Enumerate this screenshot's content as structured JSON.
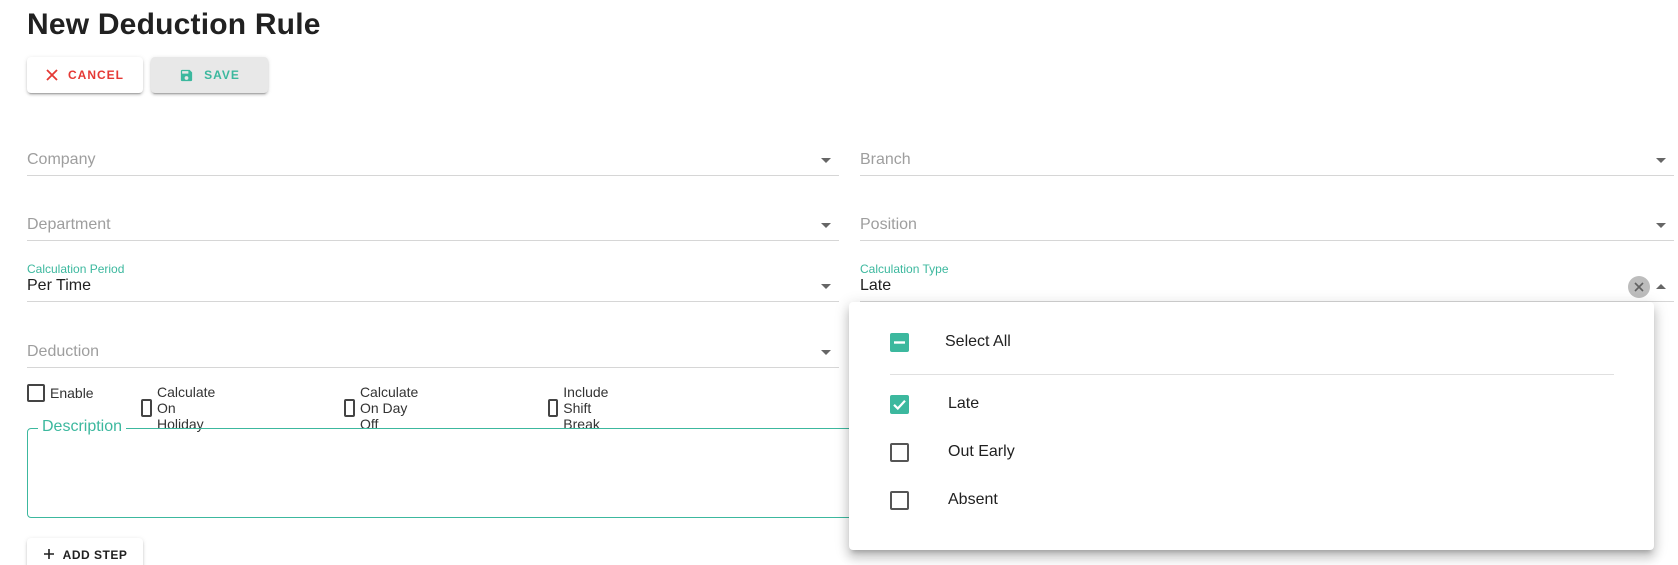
{
  "page": {
    "title": "New Deduction Rule"
  },
  "toolbar": {
    "cancel_label": "CANCEL",
    "save_label": "SAVE"
  },
  "colors": {
    "accent": "#3cb89e",
    "danger": "#e53935"
  },
  "fields": {
    "company": {
      "placeholder": "Company",
      "value": ""
    },
    "branch": {
      "placeholder": "Branch",
      "value": ""
    },
    "department": {
      "placeholder": "Department",
      "value": ""
    },
    "position": {
      "placeholder": "Position",
      "value": ""
    },
    "calculation_period": {
      "label": "Calculation Period",
      "value": "Per Time"
    },
    "calculation_type": {
      "label": "Calculation Type",
      "value": "Late"
    },
    "deduction": {
      "placeholder": "Deduction",
      "value": ""
    },
    "description": {
      "label": "Description",
      "value": ""
    }
  },
  "checkboxes": [
    {
      "label": "Enable",
      "checked": false
    },
    {
      "label": "Calculate On Holiday",
      "checked": false
    },
    {
      "label": "Calculate On Day Off",
      "checked": false
    },
    {
      "label": "Include Shift Break",
      "checked": false
    }
  ],
  "add_step_label": "ADD STEP",
  "calculation_type_menu": {
    "select_all": {
      "label": "Select All",
      "state": "indeterminate"
    },
    "options": [
      {
        "label": "Late",
        "checked": true
      },
      {
        "label": "Out Early",
        "checked": false
      },
      {
        "label": "Absent",
        "checked": false
      }
    ]
  },
  "icons": {
    "cancel": "close-icon",
    "save": "save-icon",
    "dropdown": "chevron-down-icon",
    "clear": "clear-icon",
    "add": "plus-icon"
  }
}
